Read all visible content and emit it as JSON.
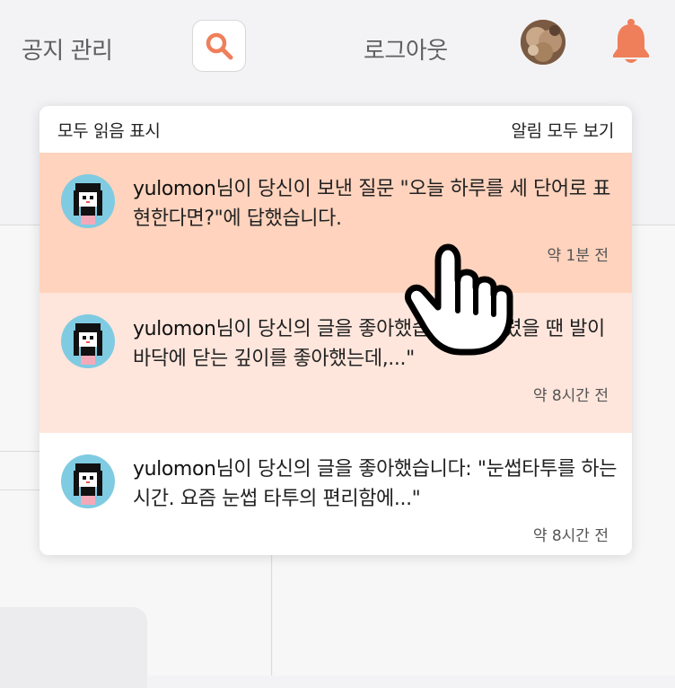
{
  "header": {
    "notice_label": "공지 관리",
    "logout_label": "로그아웃",
    "accent_color": "#ef7f5a"
  },
  "dropdown": {
    "mark_all_read": "모두 읽음 표시",
    "view_all": "알림 모두 보기",
    "notifications": [
      {
        "user": "yulomon",
        "text": "님이 당신이 보낸 질문 \"오늘 하루를 세 단어로 표현한다면?\"에 답했습니다.",
        "time": "약 1분 전",
        "bg": "#ffd3bd"
      },
      {
        "user": "yulomon",
        "text": "님이 당신의 글을 좋아했습니다: \"어렸을 땐 발이 바닥에 닫는 깊이를 좋아했는데,...\"",
        "time": "약 8시간 전",
        "bg": "#ffe6dc"
      },
      {
        "user": "yulomon",
        "text": "님이 당신의 글을 좋아했습니다: \"눈썹타투를 하는 시간. 요즘 눈썹 타투의 편리함에...\"",
        "time": "약 8시간 전",
        "bg": "#ffffff"
      }
    ]
  },
  "icons": {
    "search": "search-icon",
    "bell": "bell-icon",
    "cursor": "hand-pointer-cursor"
  }
}
